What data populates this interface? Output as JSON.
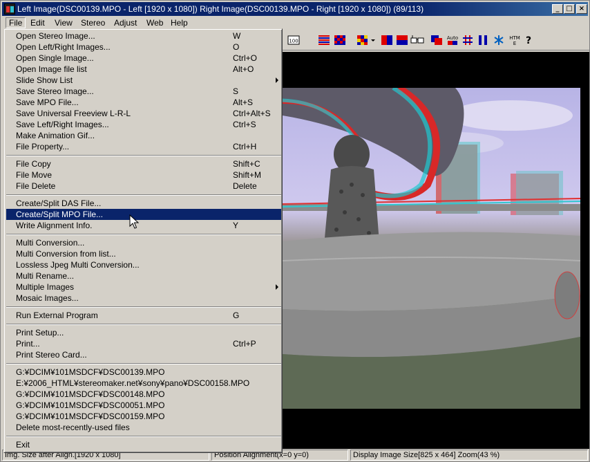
{
  "window": {
    "title": "Left Image(DSC00139.MPO - Left [1920 x 1080]) Right Image(DSC00139.MPO - Right [1920 x 1080])  (89/113)",
    "controls": {
      "minimize": "_",
      "maximize": "□",
      "close": "×"
    }
  },
  "menubar": {
    "items": [
      {
        "label": "File"
      },
      {
        "label": "Edit"
      },
      {
        "label": "View"
      },
      {
        "label": "Stereo"
      },
      {
        "label": "Adjust"
      },
      {
        "label": "Web"
      },
      {
        "label": "Help"
      }
    ]
  },
  "toolbar": {
    "zoom_label": "100",
    "help_label": "?",
    "auto_label": "Auto",
    "html_label": "HTM",
    "icons": [
      "zoom-100-icon",
      "stripes-red-blue-icon",
      "checker-icon",
      "mosaic-icon",
      "dropdown-icon",
      "red-blue-split-icon",
      "red-blue-stack-icon",
      "glasses-icon",
      "overlap-icon",
      "auto-icon",
      "grid-icon",
      "bars-icon",
      "snowflake-icon",
      "html-icon",
      "help-icon"
    ]
  },
  "file_menu": {
    "groups": [
      [
        {
          "label": "Open Stereo Image...",
          "shortcut": "W"
        },
        {
          "label": "Open Left/Right Images...",
          "shortcut": "O"
        },
        {
          "label": "Open Single Image...",
          "shortcut": "Ctrl+O"
        },
        {
          "label": "Open Image file list",
          "shortcut": "Alt+O"
        },
        {
          "label": "Slide Show List",
          "shortcut": "",
          "submenu": true
        },
        {
          "label": "Save Stereo Image...",
          "shortcut": "S"
        },
        {
          "label": "Save MPO File...",
          "shortcut": "Alt+S"
        },
        {
          "label": "Save Universal Freeview L-R-L",
          "shortcut": "Ctrl+Alt+S"
        },
        {
          "label": "Save Left/Right Images...",
          "shortcut": "Ctrl+S"
        },
        {
          "label": "Make Animation Gif...",
          "shortcut": ""
        },
        {
          "label": "File  Property...",
          "shortcut": "Ctrl+H"
        }
      ],
      [
        {
          "label": "File Copy",
          "shortcut": "Shift+C"
        },
        {
          "label": "File Move",
          "shortcut": "Shift+M"
        },
        {
          "label": "File Delete",
          "shortcut": "Delete"
        }
      ],
      [
        {
          "label": "Create/Split DAS File...",
          "shortcut": ""
        },
        {
          "label": "Create/Split MPO File...",
          "shortcut": "",
          "highlighted": true
        },
        {
          "label": "Write Alignment Info.",
          "shortcut": "Y"
        }
      ],
      [
        {
          "label": "Multi Conversion...",
          "shortcut": ""
        },
        {
          "label": "Multi Conversion from list...",
          "shortcut": ""
        },
        {
          "label": "Lossless Jpeg Multi Conversion...",
          "shortcut": ""
        },
        {
          "label": "Multi Rename...",
          "shortcut": ""
        },
        {
          "label": "Multiple Images",
          "shortcut": "",
          "submenu": true
        },
        {
          "label": "Mosaic Images...",
          "shortcut": ""
        }
      ],
      [
        {
          "label": "Run External Program",
          "shortcut": "G"
        }
      ],
      [
        {
          "label": "Print Setup...",
          "shortcut": ""
        },
        {
          "label": "Print...",
          "shortcut": "Ctrl+P"
        },
        {
          "label": "Print Stereo Card...",
          "shortcut": ""
        }
      ],
      [
        {
          "label": "G:¥DCIM¥101MSDCF¥DSC00139.MPO",
          "shortcut": ""
        },
        {
          "label": "E:¥2006_HTML¥stereomaker.net¥sony¥pano¥DSC00158.MPO",
          "shortcut": ""
        },
        {
          "label": "G:¥DCIM¥101MSDCF¥DSC00148.MPO",
          "shortcut": ""
        },
        {
          "label": "G:¥DCIM¥101MSDCF¥DSC00051.MPO",
          "shortcut": ""
        },
        {
          "label": "G:¥DCIM¥101MSDCF¥DSC00159.MPO",
          "shortcut": ""
        },
        {
          "label": "Delete most-recently-used files",
          "shortcut": ""
        }
      ],
      [
        {
          "label": "Exit",
          "shortcut": ""
        }
      ]
    ]
  },
  "statusbar": {
    "left": "Img. Size after Align.[1920 x 1080]",
    "middle": "Position Alignment(x=0 y=0)",
    "right": "Display Image Size[825 x 464]  Zoom(43 %)"
  },
  "colors": {
    "title_bar": "#0a246a",
    "highlight": "#0a246a",
    "face": "#d4d0c8",
    "anaglyph_red": "#e02828",
    "anaglyph_cyan": "#20d0d8"
  }
}
